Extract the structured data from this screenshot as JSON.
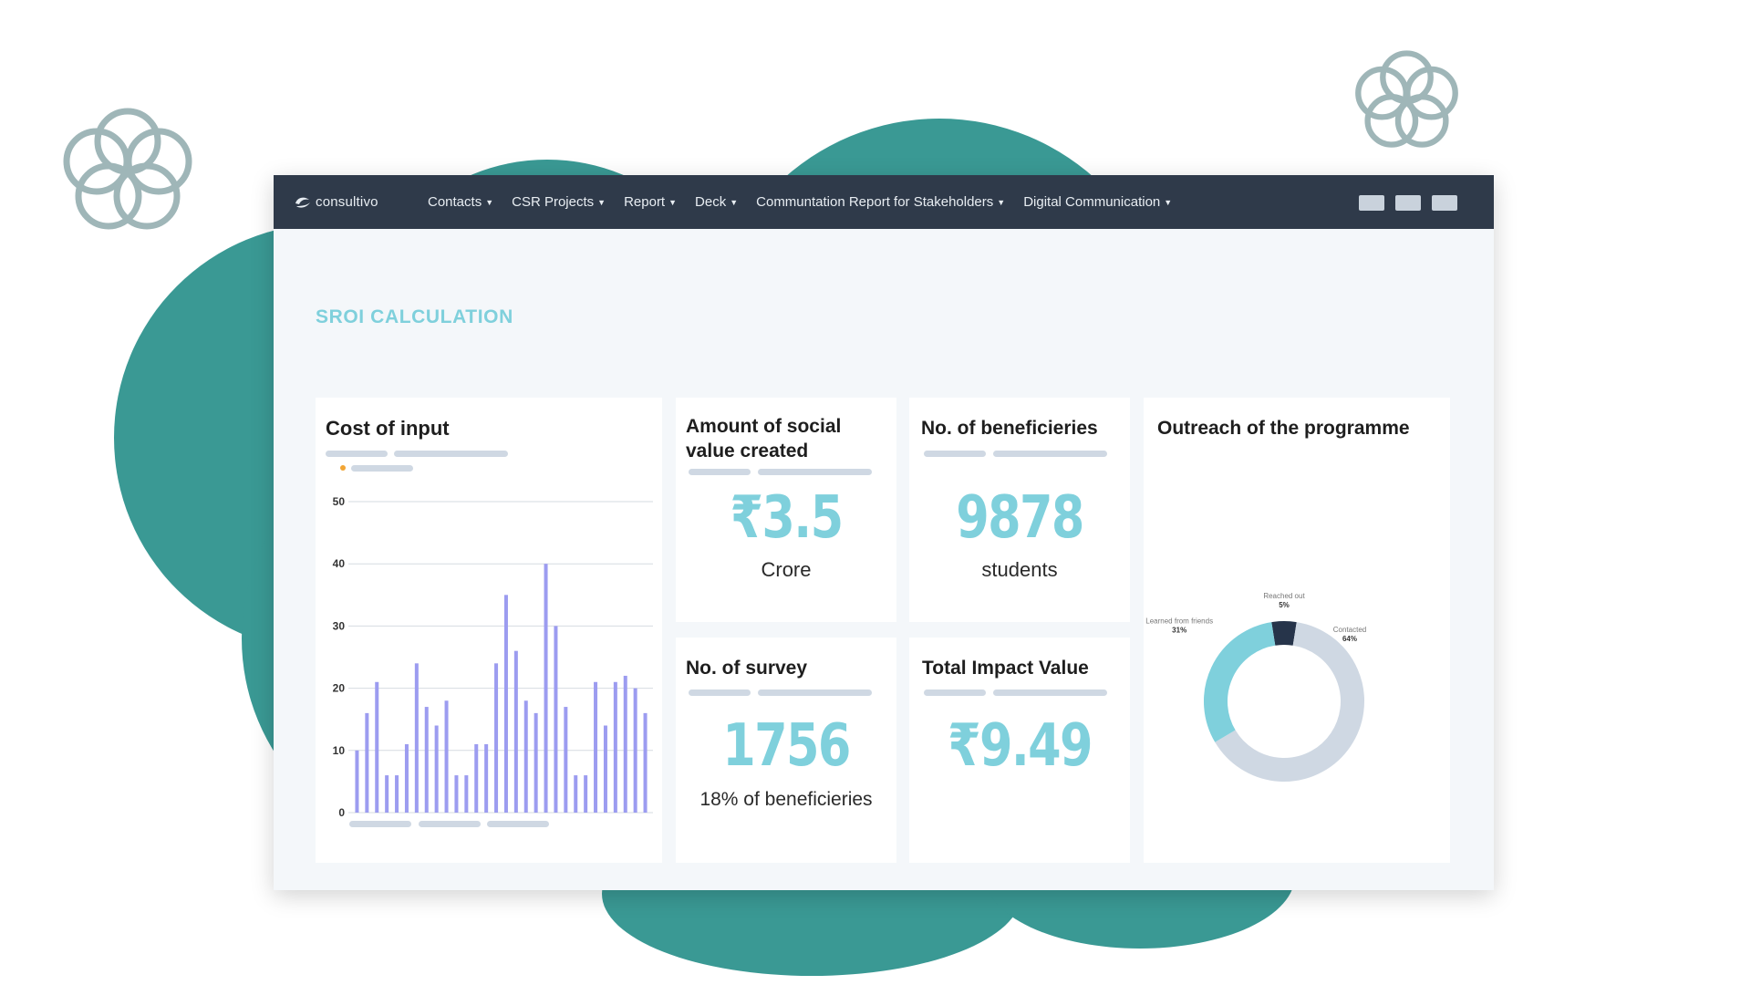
{
  "colors": {
    "background_blob": "#3a9994",
    "flower_outline": "#9fb6b8",
    "navbar": "#2f3a4a",
    "accent": "#7fd0dc",
    "bar": "#9c9cf0",
    "donut_contacted": "#cfd8e3",
    "donut_learned": "#7fd0dc",
    "donut_reached": "#26344a"
  },
  "navbar": {
    "brand": "consultivo",
    "menu": [
      {
        "label": "Contacts",
        "caret": "▼"
      },
      {
        "label": "CSR Projects",
        "caret": "▼"
      },
      {
        "label": "Report",
        "caret": "▼"
      },
      {
        "label": "Deck",
        "caret": "▼"
      },
      {
        "label": "Communtation Report for Stakeholders",
        "caret": "▼"
      },
      {
        "label": "Digital Communication",
        "caret": "▼"
      }
    ]
  },
  "page": {
    "title": "SROI CALCULATION"
  },
  "cards": {
    "cost": {
      "title": "Cost of input"
    },
    "social_value": {
      "title": "Amount of social value created",
      "value": "₹3.5",
      "sub": "Crore"
    },
    "beneficiaries": {
      "title": "No. of beneficieries",
      "value": "9878",
      "sub": "students"
    },
    "survey": {
      "title": "No. of survey",
      "value": "1756",
      "sub": "18% of beneficieries"
    },
    "impact": {
      "title": "Total Impact Value",
      "value": "₹9.49"
    },
    "outreach": {
      "title": "Outreach of the programme"
    }
  },
  "chart_data": [
    {
      "type": "bar",
      "title": "Cost of input",
      "ylim": [
        0,
        50
      ],
      "yticks": [
        0,
        10,
        20,
        30,
        40,
        50
      ],
      "grid": true,
      "values": [
        10,
        16,
        21,
        6,
        6,
        11,
        24,
        17,
        14,
        18,
        6,
        6,
        11,
        11,
        24,
        35,
        26,
        18,
        16,
        40,
        30,
        17,
        6,
        6,
        21,
        14,
        21,
        22,
        20,
        16
      ]
    },
    {
      "type": "pie",
      "title": "Outreach of the programme",
      "slices": [
        {
          "label": "Contacted",
          "value": 64,
          "pct_label": "64%"
        },
        {
          "label": "Learned from friends",
          "value": 31,
          "pct_label": "31%"
        },
        {
          "label": "Reached out",
          "value": 5,
          "pct_label": "5%"
        }
      ]
    }
  ]
}
